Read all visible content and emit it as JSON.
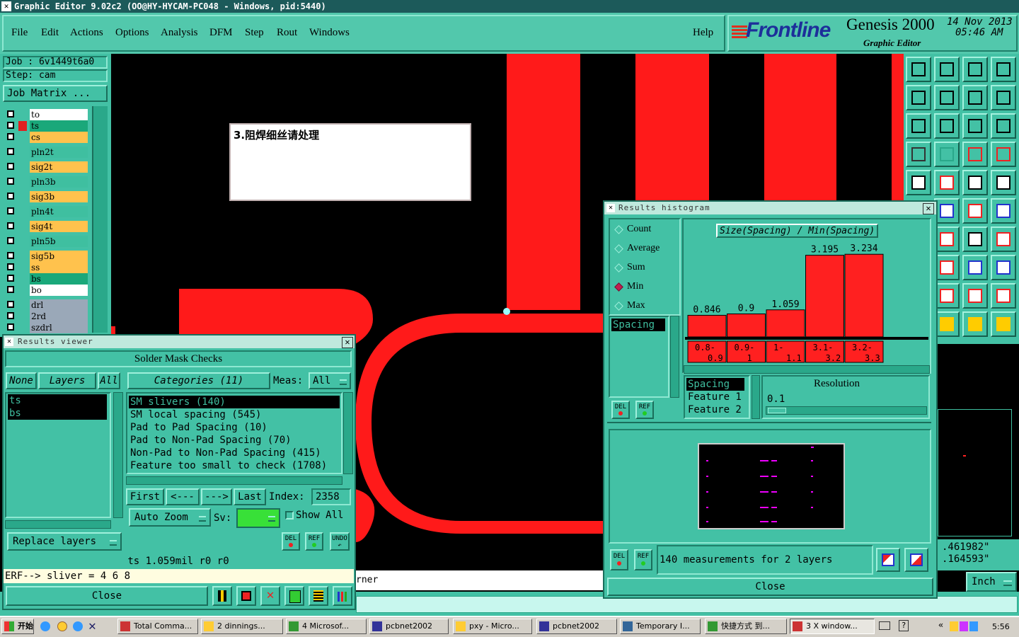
{
  "window": {
    "title": "Graphic Editor 9.02c2 (OO@HY-HYCAM-PC048 - Windows, pid:5440)"
  },
  "menu": {
    "items": [
      "File",
      "Edit",
      "Actions",
      "Options",
      "Analysis",
      "DFM",
      "Step",
      "Rout",
      "Windows"
    ],
    "help": "Help"
  },
  "brand": {
    "logo": "Frontline",
    "product": "Genesis 2000",
    "subtitle": "Graphic Editor",
    "date": "14 Nov 2013",
    "time": "05:46 AM"
  },
  "job": {
    "job_label": "Job : 6v1449t6a0",
    "step_label": "Step: cam",
    "matrix_button": "Job Matrix ..."
  },
  "layers": [
    {
      "name": "to",
      "color": "#ffffff"
    },
    {
      "name": "ts",
      "color": "#1aa87a"
    },
    {
      "name": "cs",
      "color": "#ffc24d"
    },
    {
      "name": "pln2t",
      "color": "#3fbfa0"
    },
    {
      "name": "sig2t",
      "color": "#ffc24d"
    },
    {
      "name": "pln3b",
      "color": "#3fbfa0"
    },
    {
      "name": "sig3b",
      "color": "#ffc24d"
    },
    {
      "name": "pln4t",
      "color": "#3fbfa0"
    },
    {
      "name": "sig4t",
      "color": "#ffc24d"
    },
    {
      "name": "pln5b",
      "color": "#3fbfa0"
    },
    {
      "name": "sig5b",
      "color": "#ffc24d"
    },
    {
      "name": "ss",
      "color": "#ffc24d"
    },
    {
      "name": "bs",
      "color": "#1aa87a"
    },
    {
      "name": "bo",
      "color": "#ffffff"
    },
    {
      "name": "drl",
      "color": "#9aa8b8"
    },
    {
      "name": "2rd",
      "color": "#9aa8b8"
    },
    {
      "name": "szdrl",
      "color": "#9aa8b8"
    }
  ],
  "note": {
    "text": "3.阻焊细丝请处理"
  },
  "results_viewer": {
    "title": "Results viewer",
    "header": "Solder Mask Checks",
    "none_btn": "None",
    "layers_btn": "Layers",
    "all_btn": "All",
    "categories_btn": "Categories (11)",
    "meas_label": "Meas:",
    "meas_value": "All",
    "layers_list": [
      "ts",
      "bs"
    ],
    "categories": [
      "SM slivers (140)",
      "SM local spacing (545)",
      "Pad to Pad Spacing (10)",
      "Pad to Non-Pad Spacing (70)",
      "Non-Pad to Non-Pad Spacing (415)",
      "Feature too small to check (1708)"
    ],
    "first": "First",
    "prev": "<---",
    "next": "--->",
    "last": "Last",
    "index_label": "Index:",
    "index_value": "2358",
    "auto_zoom": "Auto Zoom",
    "sv_label": "Sv:",
    "show_all": "Show All",
    "replace_layers": "Replace layers",
    "del": "DEL",
    "ref": "REF",
    "undo": "UNDO",
    "status": "ts 1.059mil   r0   r0",
    "erf": "ERF--> sliver = 4 6 8",
    "close": "Close"
  },
  "histogram": {
    "title": "Results histogram",
    "modes": [
      "Count",
      "Average",
      "Sum",
      "Min",
      "Max"
    ],
    "selected_mode": "Min",
    "chart_title": "Size(Spacing) / Min(Spacing)",
    "measure_list": [
      "Spacing"
    ],
    "resolution_label": "Resolution",
    "resolution_value": "0.1",
    "feature_list": [
      "Spacing",
      "Feature 1",
      "Feature 2"
    ],
    "summary": "140 measurements for 2 layers",
    "close": "Close",
    "del": "DEL",
    "ref": "REF"
  },
  "chart_data": {
    "type": "bar",
    "title": "Size(Spacing) / Min(Spacing)",
    "categories": [
      "0.8-0.9",
      "0.9-1",
      "1-1.1",
      "3.1-3.2",
      "3.2-3.3"
    ],
    "category_lines": [
      [
        "0.8-",
        "0.9"
      ],
      [
        "0.9-",
        "1"
      ],
      [
        "1-",
        "1.1"
      ],
      [
        "3.1-",
        "3.2"
      ],
      [
        "3.2-",
        "3.3"
      ]
    ],
    "values": [
      0.846,
      0.9,
      1.059,
      3.195,
      3.234
    ],
    "value_labels": [
      "0.846",
      "0.9",
      "1.059",
      "3.195",
      "3.234"
    ],
    "ylim": [
      0,
      3.6
    ],
    "bar_color": "#ff2020",
    "grid": false
  },
  "coords": {
    "x": ".461982\"",
    "y": ".164593\"",
    "unit": "Inch"
  },
  "status_line": {
    "text": "rner"
  },
  "taskbar": {
    "start": "开始",
    "tasks": [
      "Total Comma...",
      "2 dinnings...",
      "4 Microsof...",
      "pcbnet2002",
      "pxy - Micro...",
      "pcbnet2002",
      "Temporary I...",
      "快捷方式 到...",
      "3 X window..."
    ],
    "clock": "5:56"
  },
  "colors": {
    "accent": "#43c1a5",
    "copper": "#ff1a1a",
    "canvas": "#000000"
  }
}
